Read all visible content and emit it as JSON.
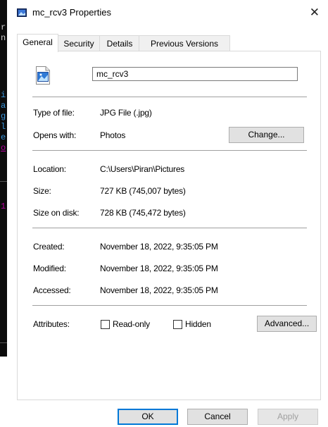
{
  "terminal": {
    "lines": [
      {
        "text": "r",
        "color": "#cccccc"
      },
      {
        "text": "n",
        "color": "#cccccc"
      },
      {
        "text": "i",
        "color": "#3a96dd"
      },
      {
        "text": "a",
        "color": "#3a96dd"
      },
      {
        "text": "g",
        "color": "#3a96dd"
      },
      {
        "text": "l",
        "color": "#3a96dd"
      },
      {
        "text": "e",
        "color": "#3a96dd"
      },
      {
        "text": "o",
        "color": "#b4009e"
      },
      {
        "text": "1",
        "color": "#b4009e"
      }
    ]
  },
  "window": {
    "title": "mc_rcv3 Properties",
    "close_glyph": "✕"
  },
  "tabs": [
    "General",
    "Security",
    "Details",
    "Previous Versions"
  ],
  "general": {
    "file_name": "mc_rcv3",
    "type_label": "Type of file:",
    "type_value": "JPG File (.jpg)",
    "opens_label": "Opens with:",
    "opens_value": "Photos",
    "change_button": "Change...",
    "location_label": "Location:",
    "location_value": "C:\\Users\\Piran\\Pictures",
    "size_label": "Size:",
    "size_value": "727 KB (745,007 bytes)",
    "size_on_disk_label": "Size on disk:",
    "size_on_disk_value": "728 KB (745,472 bytes)",
    "created_label": "Created:",
    "created_value": "November 18, 2022, 9:35:05 PM",
    "modified_label": "Modified:",
    "modified_value": "November 18, 2022, 9:35:05 PM",
    "accessed_label": "Accessed:",
    "accessed_value": "November 18, 2022, 9:35:05 PM",
    "attributes_label": "Attributes:",
    "readonly_label": "Read-only",
    "readonly_checked": false,
    "hidden_label": "Hidden",
    "hidden_checked": false,
    "advanced_button": "Advanced..."
  },
  "footer": {
    "ok": "OK",
    "cancel": "Cancel",
    "apply": "Apply"
  },
  "colors": {
    "accent": "#0078d7",
    "terminal_bg": "#0c0c0c"
  },
  "icons": {
    "title": "image-file-icon",
    "file": "image-file-icon"
  }
}
